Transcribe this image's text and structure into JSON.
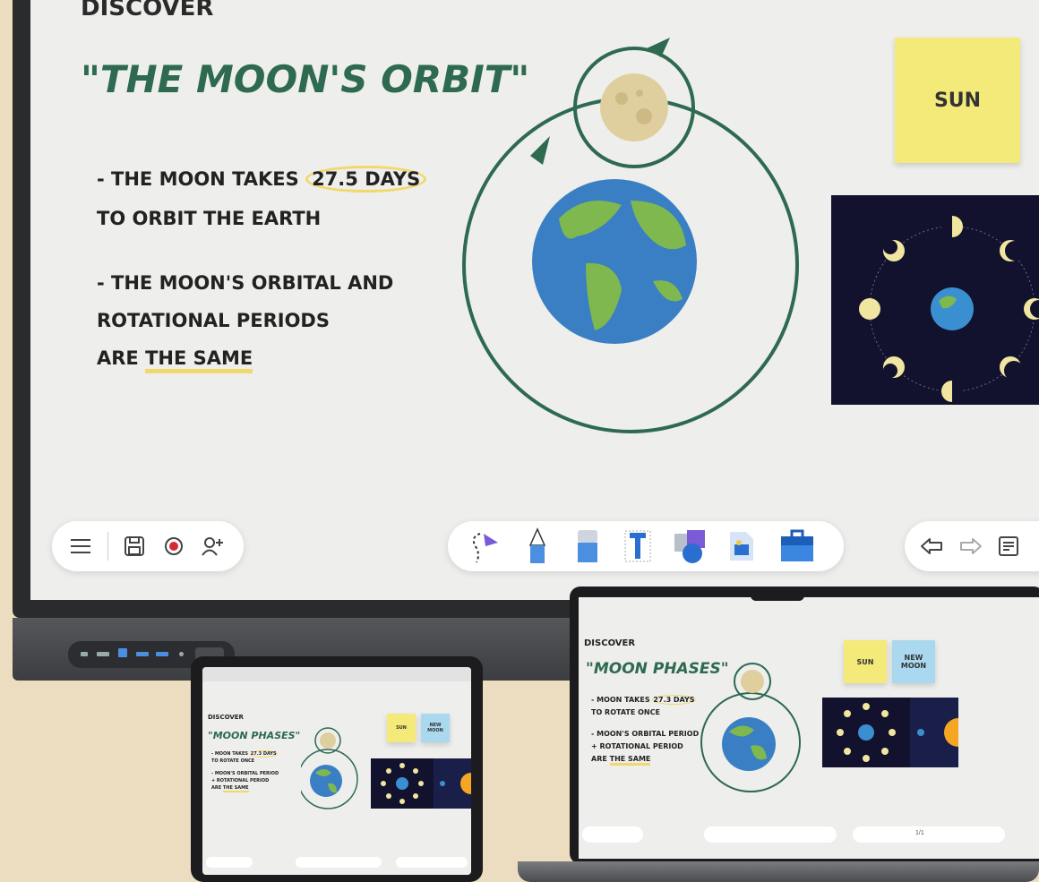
{
  "board": {
    "heading": "Discover",
    "title": "\"The Moon's orbit\"",
    "bullet1_pre": "- The Moon takes ",
    "bullet1_hl": "27.5 days",
    "bullet1_line2": "to orbit the Earth",
    "bullet2_line1": "- The Moon's orbital and",
    "bullet2_line2": "rotational periods",
    "bullet2_pre": "are ",
    "bullet2_ul": "the same",
    "sticky_sun": "Sun"
  },
  "toolbar_left": {
    "icons": [
      "menu-icon",
      "save-icon",
      "record-icon",
      "add-user-icon"
    ]
  },
  "toolbar_center": {
    "tools": [
      "lasso-select-tool",
      "pen-tool",
      "eraser-tool",
      "text-tool",
      "shapes-tool",
      "image-tool",
      "toolbox-tool"
    ]
  },
  "toolbar_right": {
    "icons": [
      "undo-icon",
      "redo-icon",
      "settings-panel-icon"
    ]
  },
  "device": {
    "heading": "Discover",
    "title": "\"Moon phases\"",
    "bullet1_pre": "- Moon takes ",
    "bullet1_hl": "27.3 days",
    "bullet1_line2": "to rotate once",
    "bullet2_line1": "- Moon's orbital period",
    "bullet2_line2": "+ rotational period",
    "bullet2_pre": "are ",
    "bullet2_ul": "the same",
    "sticky_sun": "Sun",
    "sticky_newmoon": "New Moon",
    "page_indicator": "1/1"
  },
  "colors": {
    "green": "#2d6a4f",
    "sticky_yellow": "#f4ea7a",
    "sticky_blue": "#a9d8ef",
    "highlight": "#f0d96a",
    "earth_ocean": "#3a7fc4",
    "earth_land": "#7fb84e"
  }
}
